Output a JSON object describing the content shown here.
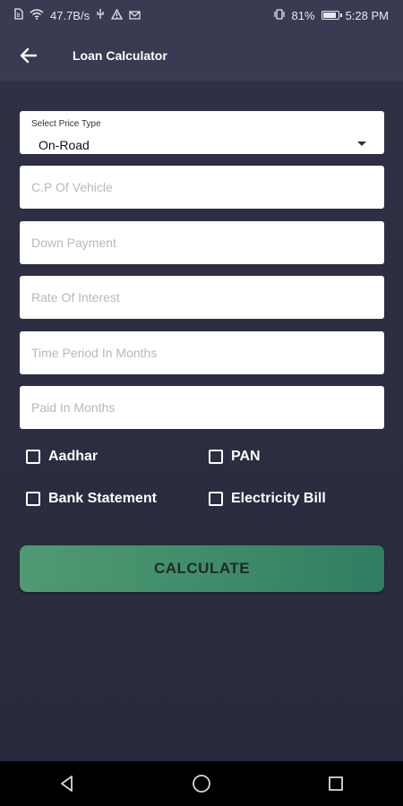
{
  "status_bar": {
    "net_speed": "47.7B/s",
    "battery": "81%",
    "time": "5:28 PM"
  },
  "app_bar": {
    "title": "Loan Calculator"
  },
  "form": {
    "price_type": {
      "label": "Select Price Type",
      "value": "On-Road"
    },
    "cp_vehicle_placeholder": "C.P Of Vehicle",
    "down_payment_placeholder": "Down Payment",
    "rate_placeholder": "Rate Of Interest",
    "time_period_placeholder": "Time Period In Months",
    "paid_months_placeholder": "Paid In Months"
  },
  "documents": {
    "aadhar": "Aadhar",
    "pan": "PAN",
    "bank_statement": "Bank Statement",
    "electricity_bill": "Electricity Bill"
  },
  "calculate_label": "CALCULATE",
  "colors": {
    "background": "#2b2c40",
    "app_bar": "#3a3b52",
    "button_green": "#3e8a68"
  }
}
